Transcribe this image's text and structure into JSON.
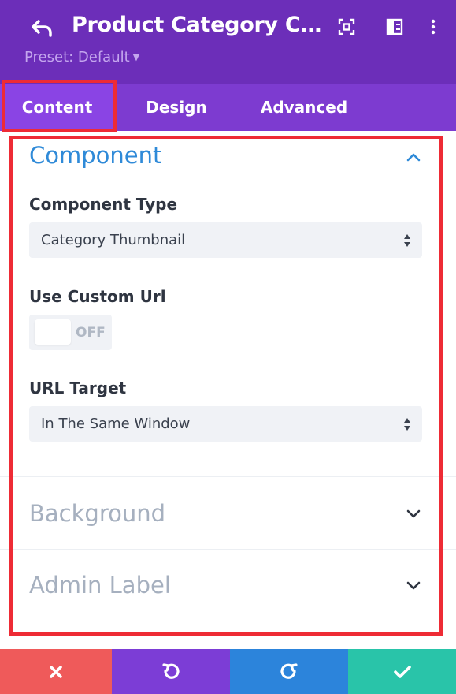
{
  "header": {
    "title": "Product Category Com…",
    "preset_label": "Preset: Default",
    "icons": [
      "back-arrow-icon",
      "focus-icon",
      "split-view-icon",
      "more-vertical-icon"
    ]
  },
  "tabs": [
    {
      "label": "Content",
      "active": true
    },
    {
      "label": "Design",
      "active": false
    },
    {
      "label": "Advanced",
      "active": false
    }
  ],
  "component_section": {
    "title": "Component",
    "component_type_label": "Component Type",
    "component_type_value": "Category Thumbnail",
    "use_custom_url_label": "Use Custom Url",
    "use_custom_url_state": "OFF",
    "url_target_label": "URL Target",
    "url_target_value": "In The Same Window"
  },
  "collapsed_sections": [
    {
      "title": "Background"
    },
    {
      "title": "Admin Label"
    }
  ],
  "footer": {
    "buttons": [
      "close-icon",
      "undo-icon",
      "redo-icon",
      "check-icon"
    ]
  },
  "colors": {
    "header": "#6c2eb9",
    "tabs": "#7d3bd0",
    "active_tab": "#8a44e4",
    "highlight": "#ee2b35",
    "accent_blue": "#2f8ad8",
    "cancel": "#ef5a5a",
    "undo": "#7c3dd6",
    "redo": "#2c84db",
    "save": "#29c4a9"
  }
}
